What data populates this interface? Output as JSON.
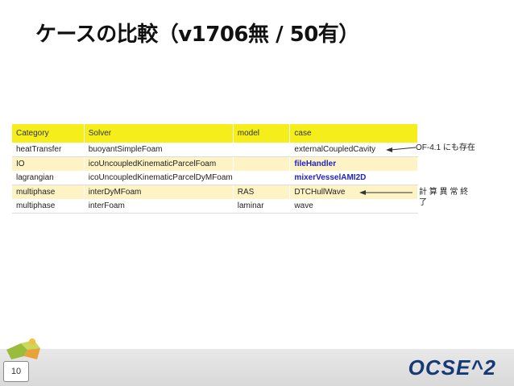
{
  "slide": {
    "title": "ケースの比較（v1706無 / 50有）",
    "page_number": "10",
    "brand": "OCSE^2"
  },
  "table": {
    "headers": [
      "Category",
      "Solver",
      "model",
      "case"
    ],
    "rows": [
      [
        "heatTransfer",
        "buoyantSimpleFoam",
        "",
        "externalCoupledCavity"
      ],
      [
        "IO",
        "icoUncoupledKinematicParcelFoam",
        "",
        "fileHandler"
      ],
      [
        "lagrangian",
        "icoUncoupledKinematicParcelDyMFoam",
        "",
        "mixerVesselAMI2D"
      ],
      [
        "multiphase",
        "interDyMFoam",
        "RAS",
        "DTCHullWave"
      ],
      [
        "multiphase",
        "interFoam",
        "laminar",
        "wave"
      ]
    ]
  },
  "notes": {
    "note1": "OF-4.1 にも存在",
    "note2_line1": "計 算 異 常 終",
    "note2_line2": "了"
  }
}
